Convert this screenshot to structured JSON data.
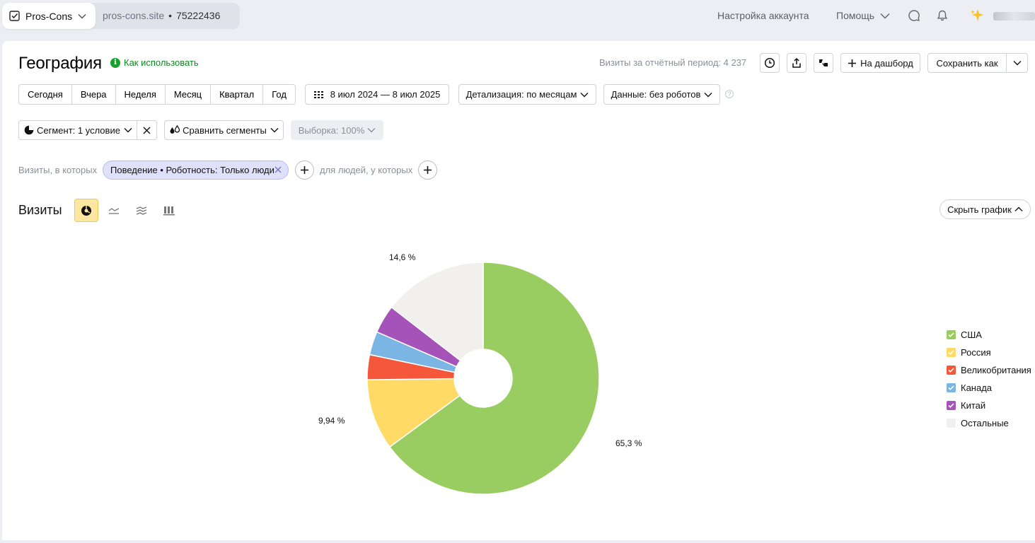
{
  "topbar": {
    "project_name": "Pros-Cons",
    "site": "pros-cons.site",
    "separator": "•",
    "counter_id": "75222436",
    "account_settings": "Настройка аккаунта",
    "help": "Помощь"
  },
  "header": {
    "title": "География",
    "how_to_use": "Как использовать",
    "visits_total": "Визиты за отчётный период: 4 237",
    "to_dashboard": "На дашборд",
    "save_as": "Сохранить как"
  },
  "periods": [
    "Сегодня",
    "Вчера",
    "Неделя",
    "Месяц",
    "Квартал",
    "Год"
  ],
  "date_range": "8 июл 2024 — 8 июл 2025",
  "detail": "Детализация: по месяцам",
  "data_mode": "Данные: без роботов",
  "segment": "Сегмент: 1 условие",
  "compare_segments": "Сравнить сегменты",
  "sample": "Выборка: 100%",
  "filter": {
    "visits_label": "Визиты, в которых",
    "chip": "Поведение • Роботность: Только люди",
    "people_label": "для людей, у которых"
  },
  "chart_section": {
    "title": "Визиты",
    "hide_chart": "Скрыть график"
  },
  "chart_data": {
    "type": "pie",
    "categories": [
      "США",
      "Россия",
      "Великобритания",
      "Канада",
      "Китай",
      "Остальные"
    ],
    "values": [
      65.3,
      9.94,
      3.5,
      3.3,
      3.96,
      14.6
    ],
    "labels": [
      "65,3 %",
      "9,94 %",
      "",
      "",
      "",
      "14,6 %"
    ],
    "colors": [
      "#99cc61",
      "#ffda66",
      "#f5573b",
      "#7bb5e3",
      "#a553b8",
      "#f1f0ed"
    ],
    "legend_position": "right"
  }
}
